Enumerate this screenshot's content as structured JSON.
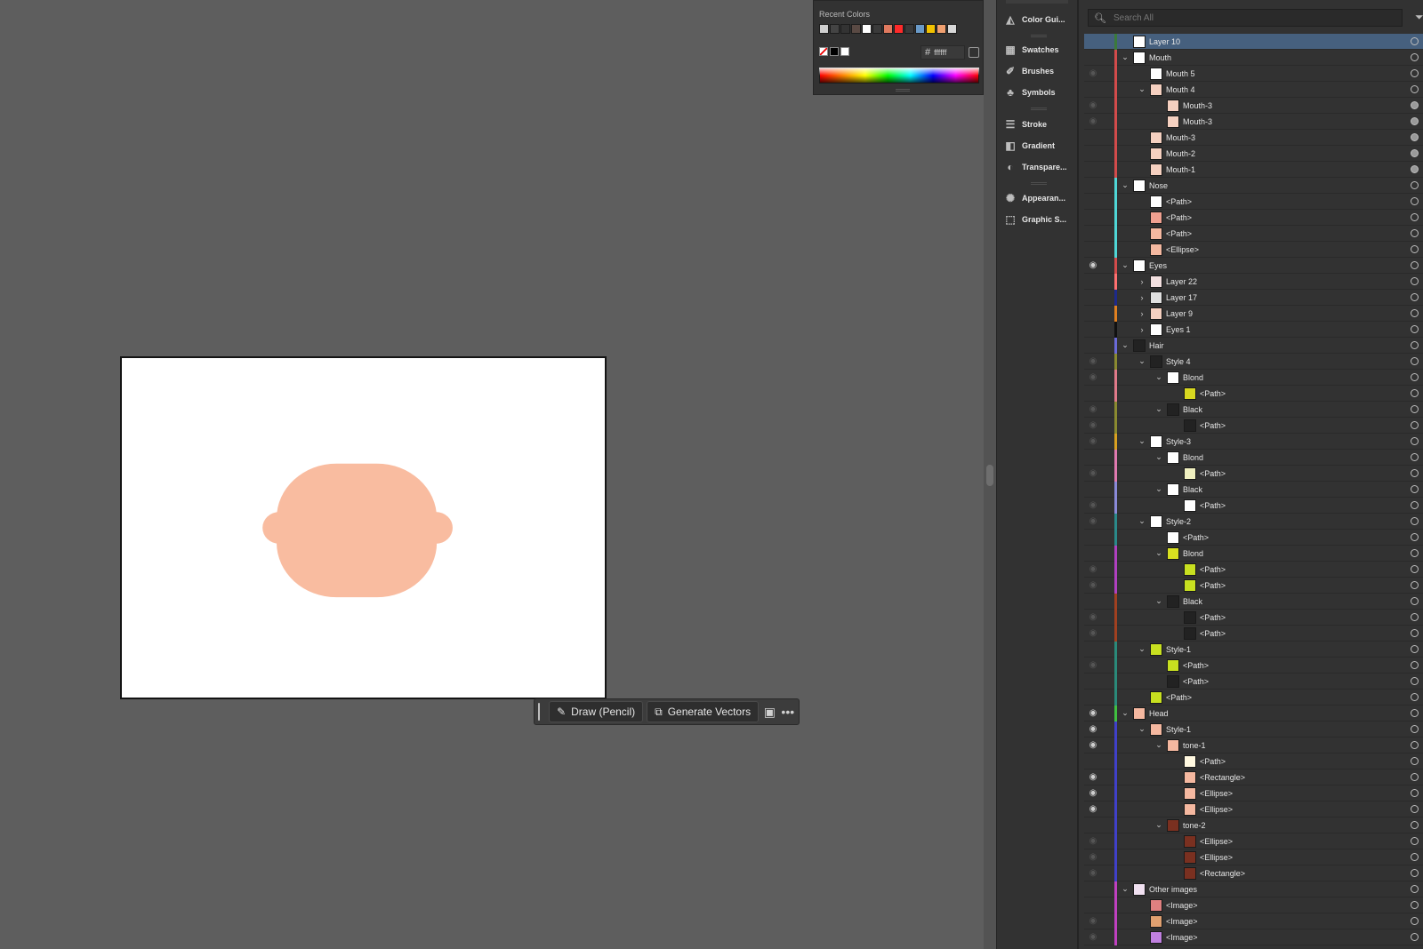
{
  "color_panel": {
    "recent_colors_label": "Recent Colors",
    "recent_colors": [
      "#cfcfcf",
      "#444444",
      "#333333",
      "#5a4a44",
      "#ffffff",
      "#3a3a3a",
      "#e07a5f",
      "#ff2a2a",
      "#3a3a3a",
      "#6a9ac8",
      "#f2c200",
      "#f0a070",
      "#d8d8d8"
    ],
    "hex_value": "ffffff"
  },
  "dock": {
    "items": [
      {
        "label": "Color Gui...",
        "icon": "color-guide-icon"
      },
      {
        "label": "Swatches",
        "icon": "swatches-icon"
      },
      {
        "label": "Brushes",
        "icon": "brushes-icon"
      },
      {
        "label": "Symbols",
        "icon": "symbols-icon"
      },
      {
        "label": "Stroke",
        "icon": "stroke-icon"
      },
      {
        "label": "Gradient",
        "icon": "gradient-icon"
      },
      {
        "label": "Transpare...",
        "icon": "transparency-icon"
      },
      {
        "label": "Appearan...",
        "icon": "appearance-icon"
      },
      {
        "label": "Graphic S...",
        "icon": "graphic-styles-icon"
      }
    ]
  },
  "taskbar": {
    "draw_label": "Draw (Pencil)",
    "generate_label": "Generate Vectors"
  },
  "layers": {
    "search_placeholder": "Search All",
    "rows": [
      {
        "name": "Layer 10",
        "depth": 0,
        "chev": "",
        "eye": "none",
        "color": "#3b7a3b",
        "thumb": "#ffffff",
        "selected": true
      },
      {
        "name": "Mouth",
        "depth": 0,
        "chev": "down",
        "eye": "none",
        "color": "#d24b4b",
        "thumb": "#ffffff"
      },
      {
        "name": "Mouth 5",
        "depth": 1,
        "chev": "",
        "eye": "dim",
        "color": "#d24b4b",
        "thumb": "#ffffff"
      },
      {
        "name": "Mouth 4",
        "depth": 1,
        "chev": "down",
        "eye": "none",
        "color": "#d24b4b",
        "thumb": "#f5d0c0"
      },
      {
        "name": "Mouth-3",
        "depth": 2,
        "chev": "",
        "eye": "dim",
        "color": "#d24b4b",
        "thumb": "#f5d0c0",
        "target": "filled"
      },
      {
        "name": "Mouth-3",
        "depth": 2,
        "chev": "",
        "eye": "dim",
        "color": "#d24b4b",
        "thumb": "#f5d0c0",
        "target": "filled"
      },
      {
        "name": "Mouth-3",
        "depth": 1,
        "chev": "",
        "eye": "none",
        "color": "#d24b4b",
        "thumb": "#f5d0c0",
        "target": "filled"
      },
      {
        "name": "Mouth-2",
        "depth": 1,
        "chev": "",
        "eye": "none",
        "color": "#d24b4b",
        "thumb": "#f5d0c0",
        "target": "filled"
      },
      {
        "name": "Mouth-1",
        "depth": 1,
        "chev": "",
        "eye": "none",
        "color": "#d24b4b",
        "thumb": "#f5d0c0",
        "target": "filled"
      },
      {
        "name": "Nose",
        "depth": 0,
        "chev": "down",
        "eye": "none",
        "color": "#4fd6d6",
        "thumb": "#ffffff"
      },
      {
        "name": "<Path>",
        "depth": 1,
        "chev": "",
        "eye": "none",
        "color": "#4fd6d6",
        "thumb": "#ffffff"
      },
      {
        "name": "<Path>",
        "depth": 1,
        "chev": "",
        "eye": "none",
        "color": "#4fd6d6",
        "thumb": "#f0a090"
      },
      {
        "name": "<Path>",
        "depth": 1,
        "chev": "",
        "eye": "none",
        "color": "#4fd6d6",
        "thumb": "#f4b8a0"
      },
      {
        "name": "<Ellipse>",
        "depth": 1,
        "chev": "",
        "eye": "none",
        "color": "#4fd6d6",
        "thumb": "#f4b8a0"
      },
      {
        "name": "Eyes",
        "depth": 0,
        "chev": "down",
        "eye": "vis",
        "color": "#d24b4b",
        "thumb": "#ffffff"
      },
      {
        "name": "Layer 22",
        "depth": 1,
        "chev": "right",
        "eye": "none",
        "color": "#ff7070",
        "thumb": "#f3e0e0"
      },
      {
        "name": "Layer 17",
        "depth": 1,
        "chev": "right",
        "eye": "none",
        "color": "#1e2a8a",
        "thumb": "#e0e0e0"
      },
      {
        "name": "Layer 9",
        "depth": 1,
        "chev": "right",
        "eye": "none",
        "color": "#e08020",
        "thumb": "#f5d0c0"
      },
      {
        "name": "Eyes 1",
        "depth": 1,
        "chev": "right",
        "eye": "none",
        "color": "#111111",
        "thumb": "#ffffff"
      },
      {
        "name": "Hair",
        "depth": 0,
        "chev": "down",
        "eye": "none",
        "color": "#6a6ad8",
        "thumb": "#222222"
      },
      {
        "name": "Style 4",
        "depth": 1,
        "chev": "down",
        "eye": "dim",
        "color": "#8a8a30",
        "thumb": "#222222"
      },
      {
        "name": "Blond",
        "depth": 2,
        "chev": "down",
        "eye": "dim",
        "color": "#e07a8a",
        "thumb": "#ffffff"
      },
      {
        "name": "<Path>",
        "depth": 3,
        "chev": "",
        "eye": "none",
        "color": "#e07a8a",
        "thumb": "#d8d820"
      },
      {
        "name": "Black",
        "depth": 2,
        "chev": "down",
        "eye": "dim",
        "color": "#8a8a30",
        "thumb": "#222222"
      },
      {
        "name": "<Path>",
        "depth": 3,
        "chev": "",
        "eye": "dim",
        "color": "#8a8a30",
        "thumb": "#222222"
      },
      {
        "name": "Style-3",
        "depth": 1,
        "chev": "down",
        "eye": "dim",
        "color": "#d8a020",
        "thumb": "#ffffff"
      },
      {
        "name": "Blond",
        "depth": 2,
        "chev": "down",
        "eye": "none",
        "color": "#e07ab0",
        "thumb": "#ffffff"
      },
      {
        "name": "<Path>",
        "depth": 3,
        "chev": "",
        "eye": "dim",
        "color": "#e07ab0",
        "thumb": "#f0f0c0"
      },
      {
        "name": "Black",
        "depth": 2,
        "chev": "down",
        "eye": "none",
        "color": "#8a8ad8",
        "thumb": "#ffffff"
      },
      {
        "name": "<Path>",
        "depth": 3,
        "chev": "",
        "eye": "dim",
        "color": "#8a8ad8",
        "thumb": "#ffffff"
      },
      {
        "name": "Style-2",
        "depth": 1,
        "chev": "down",
        "eye": "dim",
        "color": "#2a8a8a",
        "thumb": "#ffffff"
      },
      {
        "name": "<Path>",
        "depth": 2,
        "chev": "",
        "eye": "none",
        "color": "#2a8a8a",
        "thumb": "#ffffff"
      },
      {
        "name": "Blond",
        "depth": 2,
        "chev": "down",
        "eye": "none",
        "color": "#b040c0",
        "thumb": "#d8e020"
      },
      {
        "name": "<Path>",
        "depth": 3,
        "chev": "",
        "eye": "dim",
        "color": "#b040c0",
        "thumb": "#c8e020"
      },
      {
        "name": "<Path>",
        "depth": 3,
        "chev": "",
        "eye": "dim",
        "color": "#b040c0",
        "thumb": "#c8e020"
      },
      {
        "name": "Black",
        "depth": 2,
        "chev": "down",
        "eye": "none",
        "color": "#a04020",
        "thumb": "#222222"
      },
      {
        "name": "<Path>",
        "depth": 3,
        "chev": "",
        "eye": "dim",
        "color": "#a04020",
        "thumb": "#222222"
      },
      {
        "name": "<Path>",
        "depth": 3,
        "chev": "",
        "eye": "dim",
        "color": "#a04020",
        "thumb": "#222222"
      },
      {
        "name": "Style-1",
        "depth": 1,
        "chev": "down",
        "eye": "none",
        "color": "#2a8a7a",
        "thumb": "#c8e020"
      },
      {
        "name": "<Path>",
        "depth": 2,
        "chev": "",
        "eye": "dim",
        "color": "#2a8a7a",
        "thumb": "#c8e020"
      },
      {
        "name": "<Path>",
        "depth": 2,
        "chev": "",
        "eye": "none",
        "color": "#2a8a7a",
        "thumb": "#222222"
      },
      {
        "name": "<Path>",
        "depth": 1,
        "chev": "",
        "eye": "none",
        "color": "#2a8a7a",
        "thumb": "#c8e020"
      },
      {
        "name": "Head",
        "depth": 0,
        "chev": "down",
        "eye": "vis",
        "color": "#40c040",
        "thumb": "#f5b8a0"
      },
      {
        "name": "Style-1",
        "depth": 1,
        "chev": "down",
        "eye": "vis",
        "color": "#4040c8",
        "thumb": "#f5b8a0"
      },
      {
        "name": "tone-1",
        "depth": 2,
        "chev": "down",
        "eye": "vis",
        "color": "#4040c8",
        "thumb": "#f5b8a0"
      },
      {
        "name": "<Path>",
        "depth": 3,
        "chev": "",
        "eye": "none",
        "color": "#4040c8",
        "thumb": "#fff8e0"
      },
      {
        "name": "<Rectangle>",
        "depth": 3,
        "chev": "",
        "eye": "vis",
        "color": "#4040c8",
        "thumb": "#f5b8a0"
      },
      {
        "name": "<Ellipse>",
        "depth": 3,
        "chev": "",
        "eye": "vis",
        "color": "#4040c8",
        "thumb": "#f5b8a0"
      },
      {
        "name": "<Ellipse>",
        "depth": 3,
        "chev": "",
        "eye": "vis",
        "color": "#4040c8",
        "thumb": "#f5b8a0"
      },
      {
        "name": "tone-2",
        "depth": 2,
        "chev": "down",
        "eye": "none",
        "color": "#4040c8",
        "thumb": "#7a3020"
      },
      {
        "name": "<Ellipse>",
        "depth": 3,
        "chev": "",
        "eye": "dim",
        "color": "#4040c8",
        "thumb": "#7a3020"
      },
      {
        "name": "<Ellipse>",
        "depth": 3,
        "chev": "",
        "eye": "dim",
        "color": "#4040c8",
        "thumb": "#7a3020"
      },
      {
        "name": "<Rectangle>",
        "depth": 3,
        "chev": "",
        "eye": "dim",
        "color": "#4040c8",
        "thumb": "#7a3020"
      },
      {
        "name": "Other images",
        "depth": 0,
        "chev": "down",
        "eye": "none",
        "color": "#c040c0",
        "thumb": "#f0e0f0"
      },
      {
        "name": "<Image>",
        "depth": 1,
        "chev": "",
        "eye": "none",
        "color": "#c040c0",
        "thumb": "#e08080"
      },
      {
        "name": "<Image>",
        "depth": 1,
        "chev": "",
        "eye": "dim",
        "color": "#c040c0",
        "thumb": "#e0a070"
      },
      {
        "name": "<Image>",
        "depth": 1,
        "chev": "",
        "eye": "dim",
        "color": "#c040c0",
        "thumb": "#c080e0"
      }
    ]
  },
  "artwork": {
    "skin_color": "#f9bca0"
  }
}
